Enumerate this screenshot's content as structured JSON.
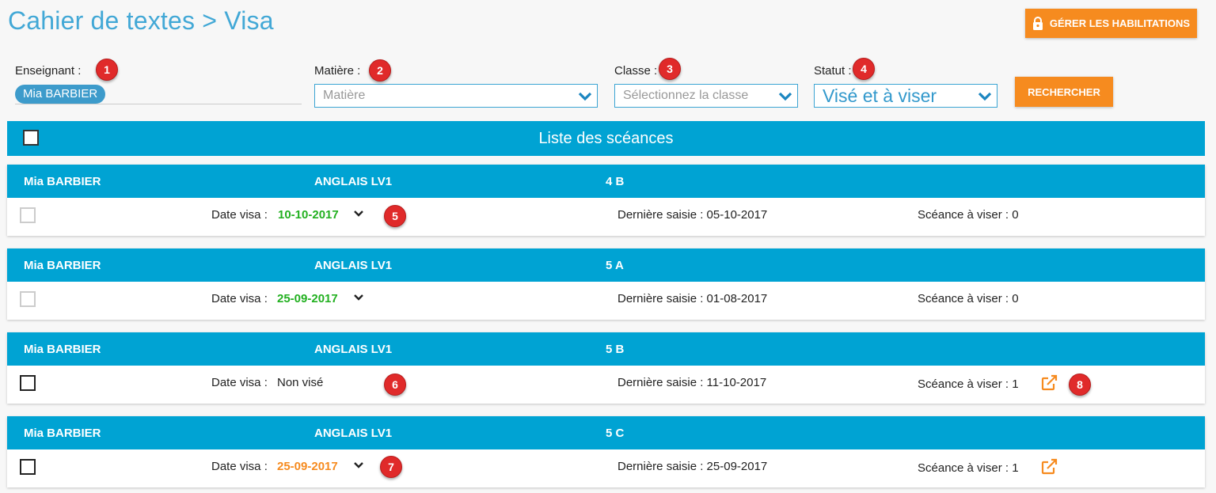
{
  "header": {
    "title": "Cahier de textes > Visa",
    "habilitations_label": "GÉRER LES HABILITATIONS"
  },
  "filters": {
    "enseignant": {
      "label": "Enseignant :",
      "chip": "Mia BARBIER"
    },
    "matiere": {
      "label": "Matière :",
      "placeholder": "Matière"
    },
    "classe": {
      "label": "Classe :",
      "placeholder": "Sélectionnez la classe"
    },
    "statut": {
      "label": "Statut :",
      "value": "Visé et à viser"
    },
    "search_label": "RECHERCHER"
  },
  "badges": [
    "1",
    "2",
    "3",
    "4",
    "5",
    "6",
    "7",
    "8"
  ],
  "list": {
    "title": "Liste des scéances",
    "rows": [
      {
        "teacher": "Mia BARBIER",
        "subject": "ANGLAIS LV1",
        "class": "4 B",
        "date_label": "Date visa :",
        "date": "10-10-2017",
        "date_status": "green",
        "last_label": "Dernière saisie : 05-10-2017",
        "count_label": "Scéance à viser : 0",
        "selectable": false
      },
      {
        "teacher": "Mia BARBIER",
        "subject": "ANGLAIS LV1",
        "class": "5 A",
        "date_label": "Date visa :",
        "date": "25-09-2017",
        "date_status": "green",
        "last_label": "Dernière saisie : 01-08-2017",
        "count_label": "Scéance à viser : 0",
        "selectable": false
      },
      {
        "teacher": "Mia BARBIER",
        "subject": "ANGLAIS LV1",
        "class": "5 B",
        "date_label": "Date visa :",
        "date": "Non visé",
        "date_status": "none",
        "last_label": "Dernière saisie : 11-10-2017",
        "count_label": "Scéance à viser : 1",
        "selectable": true
      },
      {
        "teacher": "Mia BARBIER",
        "subject": "ANGLAIS LV1",
        "class": "5 C",
        "date_label": "Date visa :",
        "date": "25-09-2017",
        "date_status": "orange",
        "last_label": "Dernière saisie : 25-09-2017",
        "count_label": "Scéance à viser : 1",
        "selectable": true
      }
    ]
  },
  "colors": {
    "accent": "#00a3d3",
    "title": "#42a8d6",
    "button": "#f68b1f",
    "badge": "#e02a2a",
    "visa_ok": "#22b020",
    "visa_late": "#f68b1f"
  },
  "icons": {
    "lock": "lock-icon",
    "chevron": "chevron-down-icon",
    "external": "external-link-icon"
  }
}
